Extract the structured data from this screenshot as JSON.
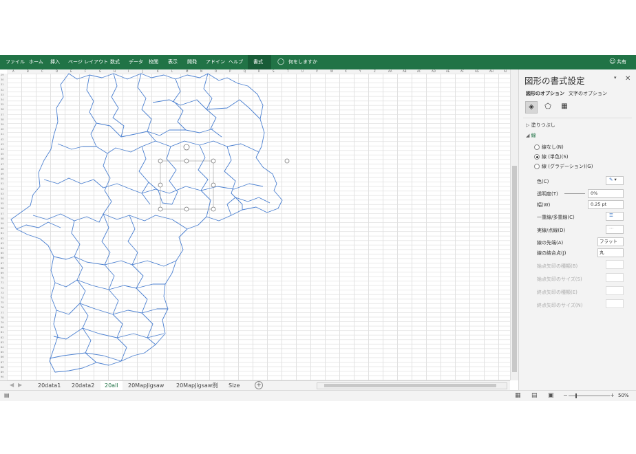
{
  "ribbon": {
    "tabs": [
      "ファイル",
      "ホーム",
      "挿入",
      "ページ レイアウト",
      "数式",
      "データ",
      "校閲",
      "表示",
      "開発",
      "アドイン",
      "ヘルプ",
      "書式"
    ],
    "active_tab": "書式",
    "tell_me": "何をしますか",
    "share": "共有"
  },
  "sheet": {
    "columns": [
      "A",
      "B",
      "C",
      "D",
      "E",
      "F",
      "G",
      "H",
      "I",
      "J",
      "K",
      "L",
      "M",
      "N",
      "O",
      "P",
      "Q",
      "R",
      "S",
      "T",
      "U",
      "V",
      "W",
      "X",
      "Y",
      "Z",
      "AA",
      "AB",
      "AC",
      "AD",
      "AE",
      "AF",
      "AG",
      "AH",
      "AI"
    ],
    "rows": [
      "29",
      "30",
      "31",
      "32",
      "33",
      "34",
      "35",
      "36",
      "37",
      "38",
      "39",
      "40",
      "41",
      "42",
      "43",
      "44",
      "45",
      "46",
      "47",
      "48",
      "49",
      "50",
      "51",
      "52",
      "53",
      "54",
      "55",
      "56",
      "57",
      "58",
      "59",
      "60",
      "61",
      "62",
      "63",
      "64",
      "65",
      "66",
      "67",
      "68",
      "69",
      "70",
      "71",
      "72",
      "73",
      "74",
      "75",
      "76",
      "77",
      "78",
      "79",
      "80",
      "81",
      "82",
      "83",
      "84",
      "85",
      "86",
      "87",
      "88",
      "89",
      "90"
    ]
  },
  "pane": {
    "title": "図形の書式設定",
    "tab_shape": "図形のオプション",
    "tab_text": "文字のオプション",
    "fill_label": "塗りつぶし",
    "line_label": "線",
    "radio_none": "線なし(N)",
    "radio_solid": "線 (単色)(S)",
    "radio_gradient": "線 (グラデーション)(G)",
    "color_label": "色(C)",
    "transparency_label": "透明度(T)",
    "transparency_value": "0%",
    "width_label": "幅(W)",
    "width_value": "0.25 pt",
    "compound_label": "一重線/多重線(C)",
    "dash_label": "実線/点線(D)",
    "cap_label": "線の先端(A)",
    "cap_value": "フラット",
    "join_label": "線の結合点(J)",
    "join_value": "丸",
    "begin_arrow_type": "始点矢印の種類(B)",
    "begin_arrow_size": "始点矢印のサイズ(S)",
    "end_arrow_type": "終点矢印の種類(E)",
    "end_arrow_size": "終点矢印のサイズ(N)"
  },
  "sheet_tabs": [
    "20data1",
    "20data2",
    "20all",
    "20MapJigsaw",
    "20MapJigsaw例",
    "Size"
  ],
  "active_sheet": "20all",
  "status": {
    "zoom": "50%"
  },
  "colors": {
    "ribbon": "#217346",
    "map_line": "#4a7fd0"
  }
}
